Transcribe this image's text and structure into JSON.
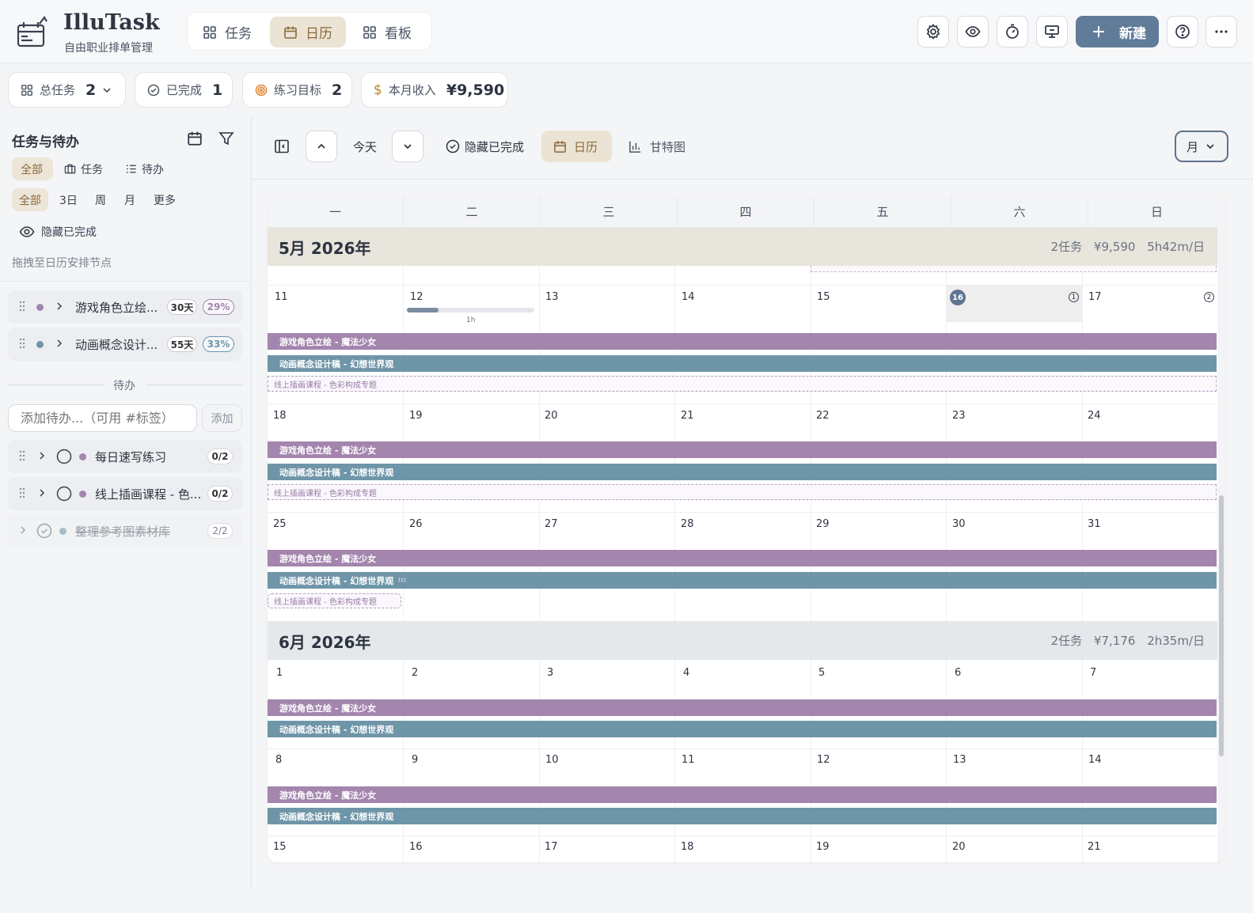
{
  "app": {
    "name": "IlluTask",
    "subtitle": "自由职业排单管理"
  },
  "nav": {
    "tabs": [
      {
        "label": "任务"
      },
      {
        "label": "日历"
      },
      {
        "label": "看板"
      }
    ]
  },
  "header": {
    "new_label": "新建"
  },
  "stats": [
    {
      "label": "总任务",
      "value": "2"
    },
    {
      "label": "已完成",
      "value": "1"
    },
    {
      "label": "练习目标",
      "value": "2"
    },
    {
      "label": "本月收入",
      "value": "¥9,590"
    }
  ],
  "sidebar": {
    "title": "任务与待办",
    "type_filters": [
      "全部",
      "任务",
      "待办"
    ],
    "range_filters": [
      "全部",
      "3日",
      "周",
      "月",
      "更多"
    ],
    "hide_done": "隐藏已完成",
    "hint": "拖拽至日历安排节点",
    "tasks": [
      {
        "name": "游戏角色立绘...",
        "days": "30天",
        "pct": "29%",
        "color": "#a385ad"
      },
      {
        "name": "动画概念设计...",
        "days": "55天",
        "pct": "33%",
        "color": "#6f95a8"
      }
    ],
    "todo_divider": "待办",
    "todo_input_placeholder": "添加待办...（可用 #标签）",
    "todo_add": "添加",
    "todos": [
      {
        "name": "每日速写练习",
        "count": "0/2",
        "done": false,
        "color": "#a385ad"
      },
      {
        "name": "线上插画课程 - 色...",
        "count": "0/2",
        "done": false,
        "color": "#a385ad"
      },
      {
        "name": "整理参考图素材库",
        "count": "2/2",
        "done": true,
        "color": "#a7bcc6"
      }
    ]
  },
  "toolbar": {
    "today": "今天",
    "hide_done": "隐藏已完成",
    "calendar": "日历",
    "gantt": "甘特图",
    "view": "月"
  },
  "calendar": {
    "weekdays": [
      "一",
      "二",
      "三",
      "四",
      "五",
      "六",
      "日"
    ],
    "may": {
      "title": "5月 2026年",
      "summary": "2任务 ¥9,590 5h42m/日"
    },
    "june": {
      "title": "6月 2026年",
      "summary": "2任务 ¥7,176 2h35m/日"
    },
    "week1": [
      "11",
      "12",
      "13",
      "14",
      "15",
      "16",
      "17"
    ],
    "week2": [
      "18",
      "19",
      "20",
      "21",
      "22",
      "23",
      "24"
    ],
    "week3": [
      "25",
      "26",
      "27",
      "28",
      "29",
      "30",
      "31"
    ],
    "week4": [
      "1",
      "2",
      "3",
      "4",
      "5",
      "6",
      "7"
    ],
    "week5": [
      "8",
      "9",
      "10",
      "11",
      "12",
      "13",
      "14"
    ],
    "week6": [
      "15",
      "16",
      "17",
      "18",
      "19",
      "20",
      "21"
    ],
    "today_count": "1",
    "sun_count": "2",
    "duration": "1h",
    "event_purple": "游戏角色立绘 - 魔法少女",
    "event_blue": "动画概念设计稿 - 幻想世界观",
    "event_dashed": "线上插画课程 - 色彩构成专题"
  }
}
